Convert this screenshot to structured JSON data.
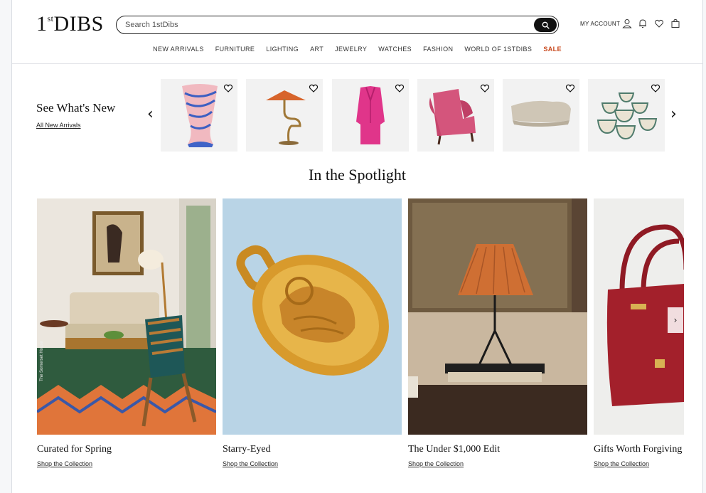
{
  "header": {
    "logo_main": "DIBS",
    "logo_1": "1",
    "logo_st": "st",
    "search_placeholder": "Search 1stDibs",
    "account_label": "MY ACCOUNT"
  },
  "nav": [
    {
      "label": "NEW ARRIVALS"
    },
    {
      "label": "FURNITURE"
    },
    {
      "label": "LIGHTING"
    },
    {
      "label": "ART"
    },
    {
      "label": "JEWELRY"
    },
    {
      "label": "WATCHES"
    },
    {
      "label": "FASHION"
    },
    {
      "label": "WORLD OF 1STDIBS"
    },
    {
      "label": "SALE"
    }
  ],
  "whats_new": {
    "title": "See What's New",
    "link": "All New Arrivals",
    "prev": "‹",
    "next": "›",
    "items": [
      "vase",
      "table-lamp",
      "pink-suit",
      "pink-armchair",
      "sofa",
      "ceramic-bowls"
    ]
  },
  "spotlight": {
    "title": "In the Spotlight",
    "photo_credit": "The Somerset House",
    "cards": [
      {
        "title": "Curated for Spring",
        "link": "Shop the Collection"
      },
      {
        "title": "Starry-Eyed",
        "link": "Shop the Collection"
      },
      {
        "title": "The Under $1,000 Edit",
        "link": "Shop the Collection"
      },
      {
        "title": "Gifts Worth Forgiving",
        "link": "Shop the Collection"
      }
    ],
    "carousel_next": "›"
  },
  "colors": {
    "sale": "#c8471b",
    "spot_blue": "#b9d4e6",
    "bag_red": "#a3202b"
  }
}
